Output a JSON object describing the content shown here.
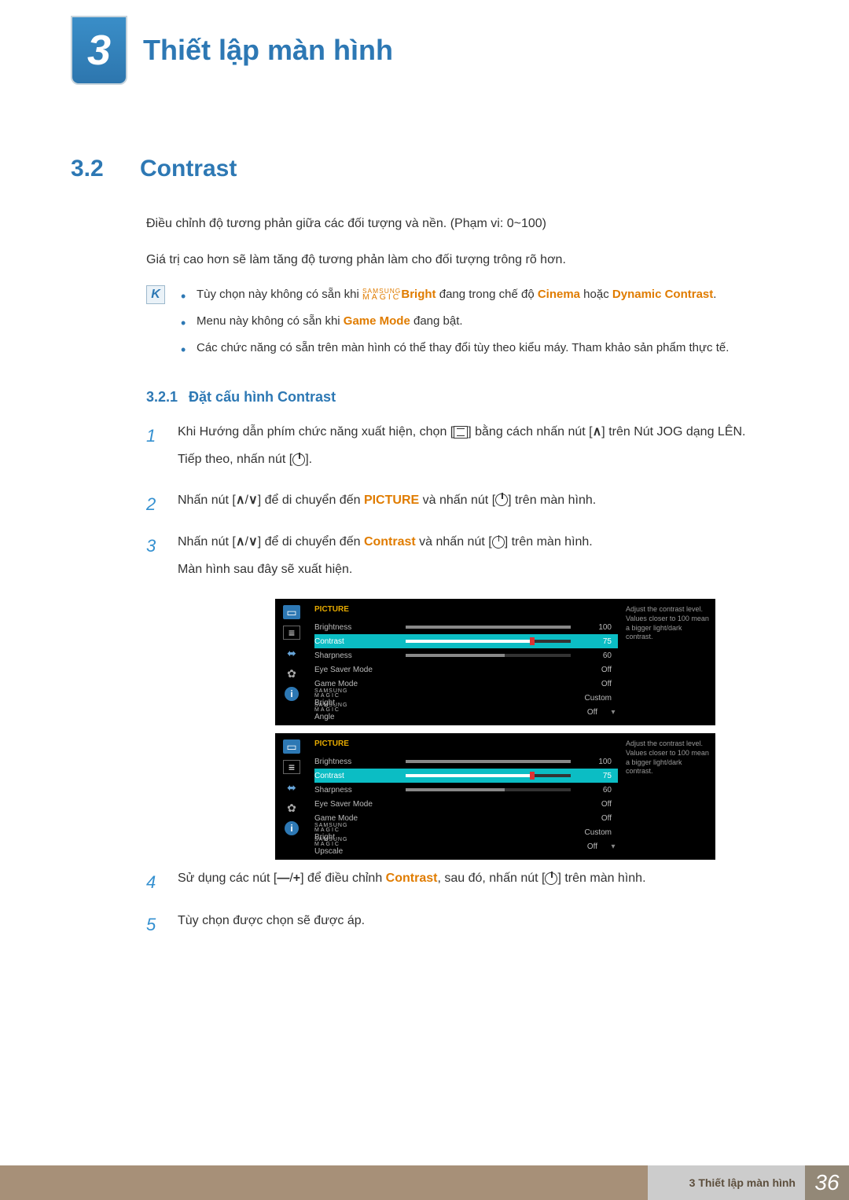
{
  "chapter": {
    "num": "3",
    "title": "Thiết lập màn hình"
  },
  "section": {
    "num": "3.2",
    "title": "Contrast"
  },
  "intro": {
    "p1": "Điều chỉnh độ tương phản giữa các đối tượng và nền. (Phạm vi: 0~100)",
    "p2": "Giá trị cao hơn sẽ làm tăng độ tương phản làm cho đối tượng trông rõ hơn."
  },
  "note": {
    "b1a": "Tùy chọn này không có sẵn khi ",
    "b1_bright": "Bright",
    "b1b": " đang trong chế độ ",
    "b1_cinema": "Cinema",
    "b1c": " hoặc ",
    "b1_dyn": "Dynamic Contrast",
    "b1d": ".",
    "b2a": "Menu này không có sẵn khi ",
    "b2_gm": "Game Mode",
    "b2b": " đang bật.",
    "b3": "Các chức năng có sẵn trên màn hình có thể thay đổi tùy theo kiểu máy. Tham khảo sản phẩm thực tế."
  },
  "subsec": {
    "num": "3.2.1",
    "title": "Đặt cấu hình Contrast"
  },
  "steps": {
    "s1a": "Khi Hướng dẫn phím chức năng xuất hiện, chọn [",
    "s1b": "] bằng cách nhấn nút [",
    "s1c": "] trên Nút JOG dạng LÊN.",
    "s1d": "Tiếp theo, nhấn nút [",
    "s1e": "].",
    "s2a": "Nhấn nút [",
    "s2b": "] để di chuyển đến ",
    "s2_pic": "PICTURE",
    "s2c": " và nhấn nút [",
    "s2d": "] trên màn hình.",
    "s3a": "Nhấn nút [",
    "s3b": "] để di chuyển đến ",
    "s3_con": "Contrast",
    "s3c": " và nhấn nút [",
    "s3d": "] trên màn hình.",
    "s3e": "Màn hình sau đây sẽ xuất hiện.",
    "s4a": "Sử dụng các nút [",
    "s4b": "] để điều chỉnh ",
    "s4_con": "Contrast",
    "s4c": ", sau đó, nhấn nút [",
    "s4d": "] trên màn hình.",
    "s5": "Tùy chọn được chọn sẽ được áp."
  },
  "osd": {
    "title": "PICTURE",
    "help": "Adjust the contrast level. Values closer to 100 mean a bigger light/dark contrast.",
    "labels": {
      "brightness": "Brightness",
      "contrast": "Contrast",
      "sharpness": "Sharpness",
      "eyesaver": "Eye Saver Mode",
      "gamemode": "Game Mode",
      "bright": "Bright",
      "angle": "Angle",
      "upscale": "Upscale"
    },
    "vals": {
      "brightness": "100",
      "contrast": "75",
      "sharpness": "60",
      "off": "Off",
      "custom": "Custom"
    }
  },
  "magic": {
    "top": "SAMSUNG",
    "bot": "MAGIC"
  },
  "footer": {
    "label": "3 Thiết lập màn hình",
    "page": "36"
  }
}
